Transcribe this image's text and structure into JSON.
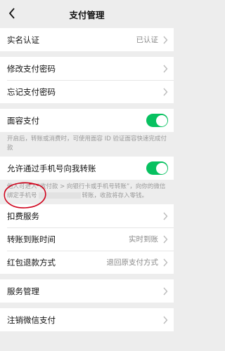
{
  "header": {
    "title": "支付管理"
  },
  "sections": {
    "realname": {
      "label": "实名认证",
      "value": "已认证"
    },
    "modify_pw": {
      "label": "修改支付密码"
    },
    "forgot_pw": {
      "label": "忘记支付密码"
    },
    "face_pay": {
      "label": "面容支付",
      "enabled": true,
      "note": "开启后，转账或消费时，可使用面容 ID 验证面容快速完成付款"
    },
    "phone_transfer": {
      "label": "允许通过手机号向我转账",
      "enabled": true,
      "note_part1": "他人可进入“收付款 > 向银行卡或手机号转账”，向你的微信绑定手机号",
      "note_part2": "转账，收款将存入零钱。"
    },
    "deduction": {
      "label": "扣费服务"
    },
    "arrival_time": {
      "label": "转账到账时间",
      "value": "实时到账"
    },
    "refund_method": {
      "label": "红包退款方式",
      "value": "退回原支付方式"
    },
    "service_mgmt": {
      "label": "服务管理"
    },
    "cancel_pay": {
      "label": "注销微信支付"
    }
  },
  "colors": {
    "toggle_on": "#07c160",
    "annotation": "#d0021b",
    "background": "#ededed"
  },
  "icons": {
    "back": "chevron-left-icon",
    "row_arrow": "chevron-right-icon"
  }
}
